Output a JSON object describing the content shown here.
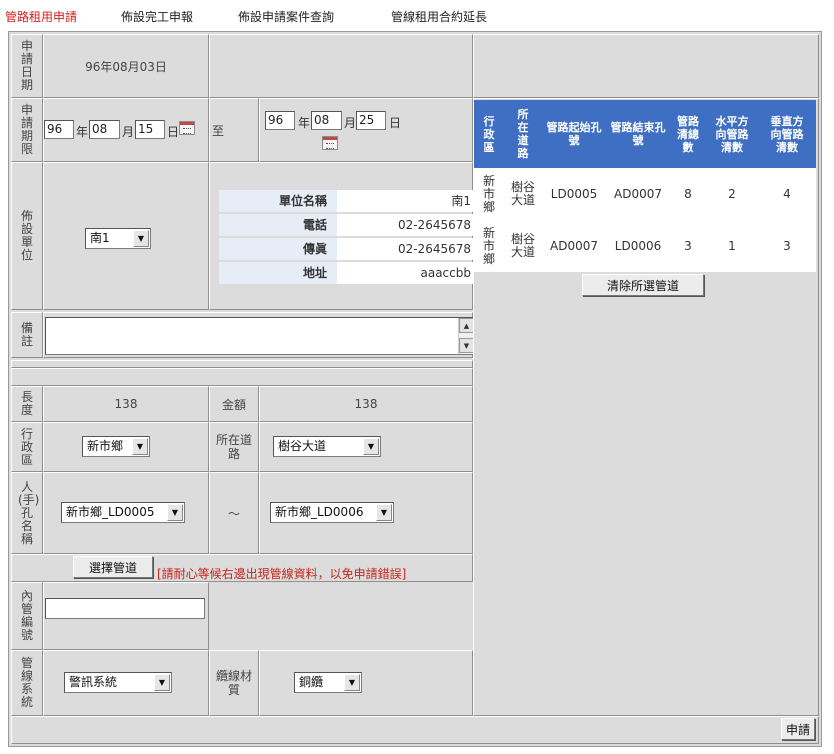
{
  "tabs": [
    "管路租用申請",
    "佈設完工申報",
    "佈設申請案件查詢",
    "管線租用合約延長"
  ],
  "form": {
    "apply_date_label": "申請日期",
    "apply_date_value": "96年08月03日",
    "period_label": "申請期限",
    "period_from": {
      "year": "96",
      "month": "08",
      "day": "15"
    },
    "period_to": {
      "year": "96",
      "month": "08",
      "day": "25"
    },
    "year_unit": "年",
    "month_unit": "月",
    "day_unit": "日",
    "to_label": "至",
    "unit_label": "佈設單位",
    "unit_value": "南1",
    "info": {
      "name_label": "單位名稱",
      "name_value": "南1",
      "phone_label": "電話",
      "phone_value": "02-2645678",
      "fax_label": "傳眞",
      "fax_value": "02-2645678",
      "address_label": "地址",
      "address_value": "aaaccbb"
    },
    "remark_label": "備註",
    "remark_value": "",
    "length_label": "長度",
    "length_value": "138",
    "amount_label": "金額",
    "amount_value": "138",
    "district_label": "行政區",
    "district_value": "新市鄉",
    "road_label": "所在道路",
    "road_value": "樹谷大道",
    "hole_label": "人(手)孔名稱",
    "hole_from_value": "新市鄉_LD0005",
    "hole_tilde": "～",
    "hole_to_value": "新市鄉_LD0006",
    "select_pipe_button": "選擇管道",
    "select_pipe_note": "[請耐心等候右邊出現管線資料，以免申請錯誤]",
    "inner_no_label": "內管編號",
    "inner_no_value": "",
    "system_label": "管線系統",
    "system_value": "警訊系統",
    "cable_material_label": "纜線材質",
    "cable_material_value": "銅纜",
    "submit_button": "申請"
  },
  "pipe_table": {
    "headers": [
      "行政區",
      "所在道路",
      "管路起始孔號",
      "管路結束孔號",
      "管路清總數",
      "水平方向管路清數",
      "垂直方向管路清數"
    ],
    "rows": [
      [
        "新市鄉",
        "樹谷大道",
        "LD0005",
        "AD0007",
        "8",
        "2",
        "4"
      ],
      [
        "新市鄉",
        "樹谷大道",
        "AD0007",
        "LD0006",
        "3",
        "1",
        "3"
      ]
    ],
    "clear_button": "清除所選管道"
  },
  "colors": {
    "active_tab": "#d21f1f",
    "table_header": "#3f6fc2",
    "info_label_bg": "#e6edf7",
    "note_text": "#c4261d",
    "panel_bg": "#dcdcdc"
  }
}
